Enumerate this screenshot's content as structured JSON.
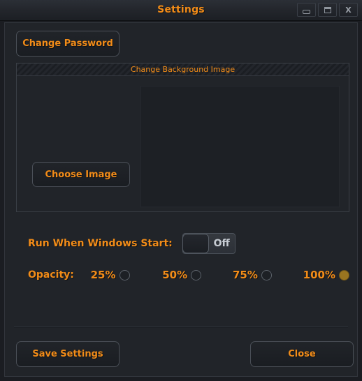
{
  "window": {
    "title": "Settings",
    "controls": [
      {
        "name": "minimize",
        "icon": "minimize-icon",
        "label": "_"
      },
      {
        "name": "maximize",
        "icon": "maximize-icon",
        "label": "□"
      },
      {
        "name": "close",
        "icon": "close-icon",
        "label": "X"
      }
    ]
  },
  "colors": {
    "accent": "#f28c18",
    "window_bg": "#1b1d22",
    "panel_bg": "#212429",
    "preview_bg": "#1d2025",
    "border": "#4a4f57",
    "radio_selected": "#9a7520",
    "toggle_text": "#c7ccd3"
  },
  "main": {
    "change_password_label": "Change Password",
    "background_group": {
      "title": "Change Background Image",
      "choose_image_label": "Choose Image",
      "preview_empty": ""
    },
    "run_on_start": {
      "label": "Run When Windows Start:",
      "toggle_state": "Off",
      "checked": false
    },
    "opacity": {
      "label": "Opacity:",
      "options": [
        {
          "label": "25%",
          "value": 25,
          "selected": false
        },
        {
          "label": "50%",
          "value": 50,
          "selected": false
        },
        {
          "label": "75%",
          "value": 75,
          "selected": false
        },
        {
          "label": "100%",
          "value": 100,
          "selected": true
        }
      ]
    }
  },
  "footer": {
    "save_label": "Save Settings",
    "close_label": "Close"
  }
}
